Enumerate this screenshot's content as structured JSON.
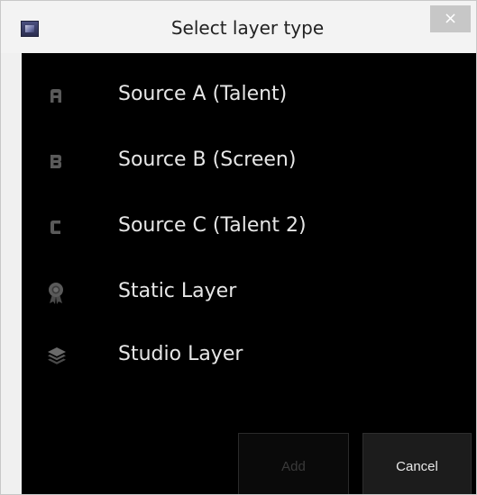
{
  "window": {
    "title": "Select layer type",
    "close_label": "×"
  },
  "layer_types": [
    {
      "label": "Source A (Talent)",
      "icon": "source-a-icon"
    },
    {
      "label": "Source B (Screen)",
      "icon": "source-b-icon"
    },
    {
      "label": "Source C (Talent 2)",
      "icon": "source-c-icon"
    },
    {
      "label": "Static Layer",
      "icon": "ribbon-icon"
    },
    {
      "label": "Studio Layer",
      "icon": "layers-stack-icon"
    }
  ],
  "buttons": {
    "add_label": "Add",
    "cancel_label": "Cancel"
  },
  "colors": {
    "background": "#000000",
    "text": "#e6e6e6",
    "icon": "#5a5a5a",
    "disabled_text": "#3a3a3a"
  }
}
